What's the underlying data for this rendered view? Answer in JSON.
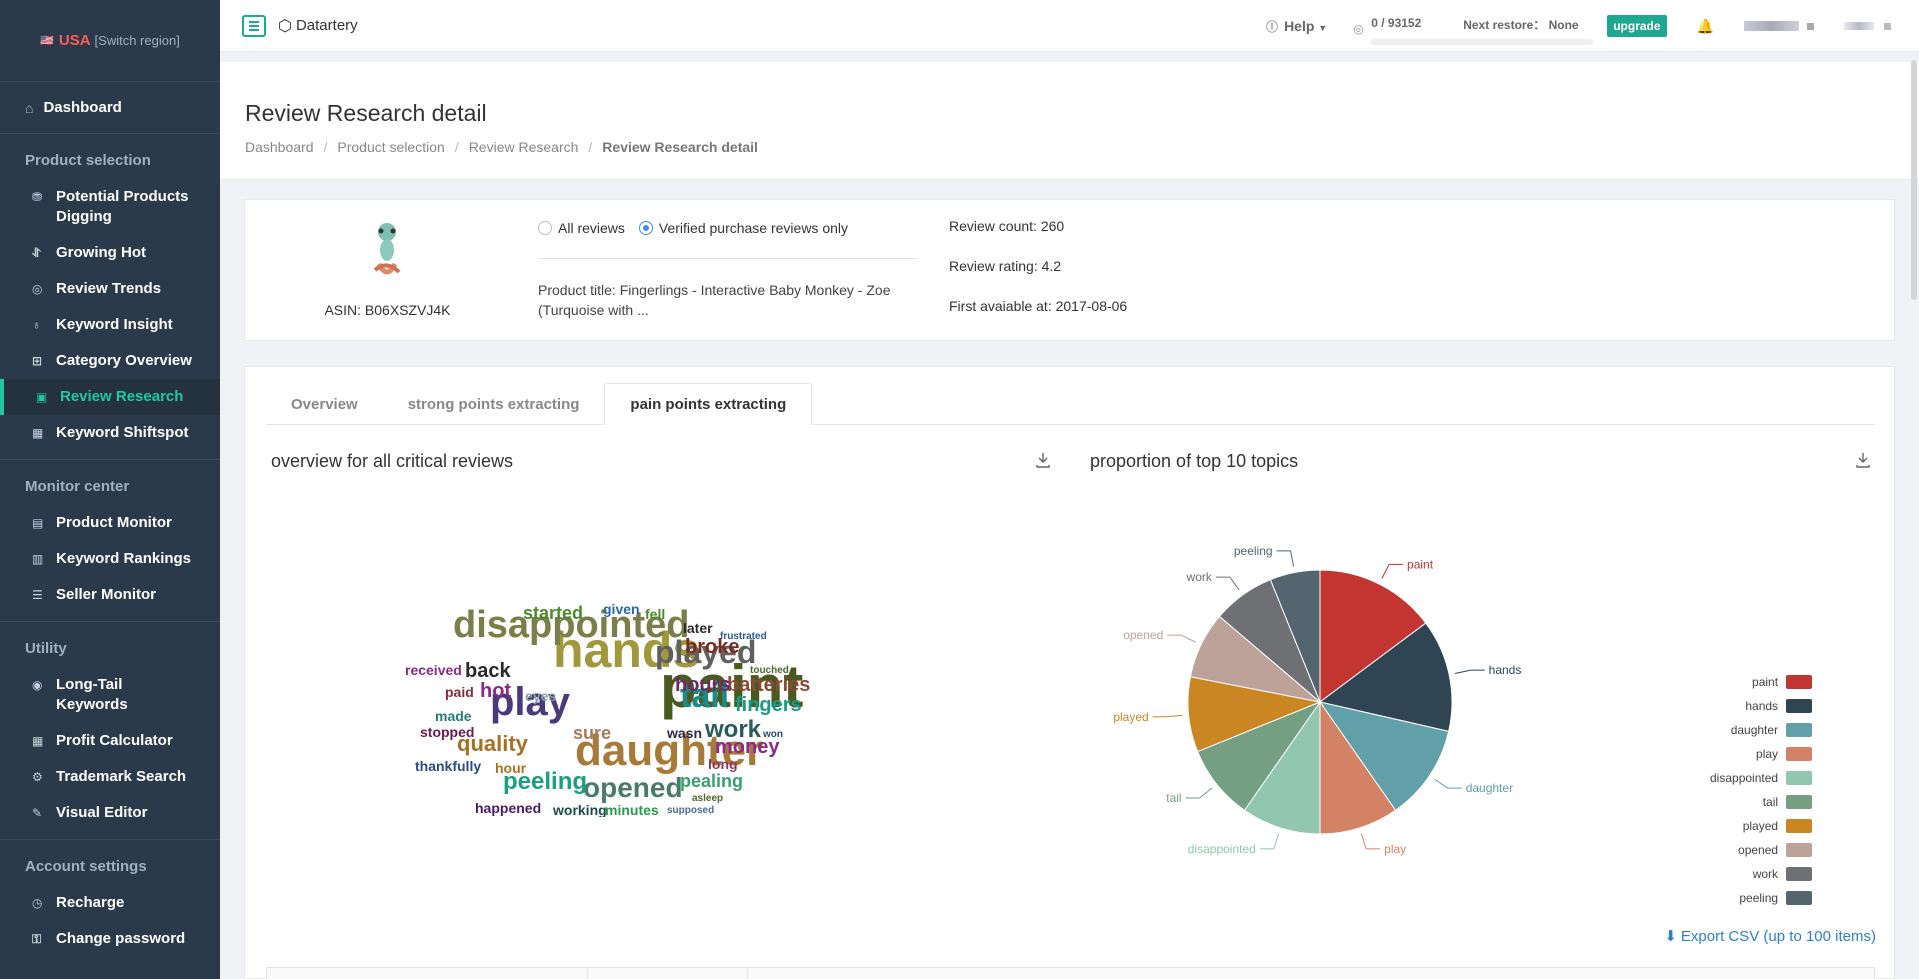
{
  "region": {
    "flag": "🇺🇸",
    "country": "USA",
    "switch": "[Switch region]"
  },
  "sidebar": {
    "dashboard": "Dashboard",
    "sections": [
      {
        "title": "Product selection",
        "items": [
          {
            "label": "Potential Products Digging",
            "icon": "dig-icon",
            "glyph": "⛃"
          },
          {
            "label": "Growing Hot",
            "icon": "trend-icon",
            "glyph": "⥯"
          },
          {
            "label": "Review Trends",
            "icon": "target-icon",
            "glyph": "◎"
          },
          {
            "label": "Keyword Insight",
            "icon": "bulb-icon",
            "glyph": "♁"
          },
          {
            "label": "Category Overview",
            "icon": "grid-icon",
            "glyph": "⊞"
          },
          {
            "label": "Review Research",
            "icon": "review-icon",
            "glyph": "▣",
            "active": true
          },
          {
            "label": "Keyword Shiftspot",
            "icon": "shift-icon",
            "glyph": "▦"
          }
        ]
      },
      {
        "title": "Monitor center",
        "items": [
          {
            "label": "Product Monitor",
            "icon": "monitor-icon",
            "glyph": "▤"
          },
          {
            "label": "Keyword Rankings",
            "icon": "bar-chart-icon",
            "glyph": "▥"
          },
          {
            "label": "Seller Monitor",
            "icon": "seller-icon",
            "glyph": "☰"
          }
        ]
      },
      {
        "title": "Utility",
        "items": [
          {
            "label": "Long-Tail Keywords",
            "icon": "keyword-icon",
            "glyph": "◉"
          },
          {
            "label": "Profit Calculator",
            "icon": "calculator-icon",
            "glyph": "▦"
          },
          {
            "label": "Trademark Search",
            "icon": "trademark-icon",
            "glyph": "⚙"
          },
          {
            "label": "Visual Editor",
            "icon": "edit-icon",
            "glyph": "✎"
          }
        ]
      },
      {
        "title": "Account settings",
        "items": [
          {
            "label": "Recharge",
            "icon": "recharge-icon",
            "glyph": "◷"
          },
          {
            "label": "Change password",
            "icon": "lock-icon",
            "glyph": "⚿"
          }
        ]
      }
    ]
  },
  "topbar": {
    "brand": "Datartery",
    "help": "Help",
    "quota_count": "0 / 93152",
    "next_restore_label": "Next restore：",
    "next_restore_value": "None",
    "upgrade": "upgrade"
  },
  "header": {
    "title": "Review Research detail",
    "breadcrumb": [
      "Dashboard",
      "Product selection",
      "Review Research",
      "Review Research detail"
    ]
  },
  "product": {
    "asin": "ASIN: B06XSZVJ4K",
    "filter_all": "All reviews",
    "filter_verified": "Verified purchase reviews only",
    "title": "Product title: Fingerlings - Interactive Baby Monkey - Zoe (Turquoise with ...",
    "review_count": "Review count: 260",
    "review_rating": "Review rating: 4.2",
    "first_available": "First avaiable at: 2017-08-06"
  },
  "tabs": [
    "Overview",
    "strong points extracting",
    "pain points extracting"
  ],
  "active_tab": 2,
  "wordcloud": {
    "title": "overview for all critical reviews",
    "words": [
      {
        "t": "paint",
        "c": "#4a5a1e",
        "s": 60
      },
      {
        "t": "hands",
        "c": "#a0983a",
        "s": 50
      },
      {
        "t": "daughter",
        "c": "#a87a3a",
        "s": 44
      },
      {
        "t": "disappointed",
        "c": "#7a7f4a",
        "s": 38
      },
      {
        "t": "play",
        "c": "#4a3a7a",
        "s": 40
      },
      {
        "t": "played",
        "c": "#606060",
        "s": 32
      },
      {
        "t": "tail",
        "c": "#1a8a8a",
        "s": 34
      },
      {
        "t": "opened",
        "c": "#4a7a6a",
        "s": 28
      },
      {
        "t": "peeling",
        "c": "#1aa080",
        "s": 24
      },
      {
        "t": "quality",
        "c": "#a87020",
        "s": 22
      },
      {
        "t": "work",
        "c": "#2a5a5a",
        "s": 24
      },
      {
        "t": "money",
        "c": "#8a2a8a",
        "s": 20
      },
      {
        "t": "pealing",
        "c": "#3aa070",
        "s": 18
      },
      {
        "t": "fingers",
        "c": "#1a9a8a",
        "s": 20
      },
      {
        "t": "batteries",
        "c": "#8a4a3a",
        "s": 20
      },
      {
        "t": "hours",
        "c": "#6a2a6a",
        "s": 20
      },
      {
        "t": "broke",
        "c": "#7a2a1a",
        "s": 20
      },
      {
        "t": "back",
        "c": "#2a2a2a",
        "s": 20
      },
      {
        "t": "hot",
        "c": "#8a2a8a",
        "s": 20
      },
      {
        "t": "sure",
        "c": "#a87a5a",
        "s": 18
      },
      {
        "t": "started",
        "c": "#4a8a2a",
        "s": 18
      },
      {
        "t": "received",
        "c": "#8a2a8a",
        "s": 14
      },
      {
        "t": "made",
        "c": "#2a7a7a",
        "s": 14
      },
      {
        "t": "stopped",
        "c": "#6a1a4a",
        "s": 14
      },
      {
        "t": "thankfully",
        "c": "#2a4a8a",
        "s": 14
      },
      {
        "t": "hour",
        "c": "#a87020",
        "s": 14
      },
      {
        "t": "happened",
        "c": "#4a1a6a",
        "s": 14
      },
      {
        "t": "working",
        "c": "#1a4a4a",
        "s": 14
      },
      {
        "t": "minutes",
        "c": "#2a9a4a",
        "s": 14
      },
      {
        "t": "wasn",
        "c": "#2a2a4a",
        "s": 14
      },
      {
        "t": "long",
        "c": "#8a3a5a",
        "s": 14
      },
      {
        "t": "given",
        "c": "#2a6a9a",
        "s": 14
      },
      {
        "t": "fell",
        "c": "#4a8a2a",
        "s": 14
      },
      {
        "t": "later",
        "c": "#2a2a2a",
        "s": 14
      },
      {
        "t": "paid",
        "c": "#8a2a3a",
        "s": 14
      },
      {
        "t": "eyes",
        "c": "#8aa0aa",
        "s": 14
      },
      {
        "t": "frustrated",
        "c": "#2a5a9a",
        "s": 10
      },
      {
        "t": "touched",
        "c": "#4a6a2a",
        "s": 10
      },
      {
        "t": "won",
        "c": "#2a4a6a",
        "s": 10
      },
      {
        "t": "asleep",
        "c": "#4a6a2a",
        "s": 10
      },
      {
        "t": "supposed",
        "c": "#4a6a9a",
        "s": 10
      }
    ]
  },
  "chart_data": {
    "type": "pie",
    "title": "proportion of top 10 topics",
    "legend_position": "right",
    "series": [
      {
        "name": "paint",
        "value": 14.5,
        "color": "#c23531"
      },
      {
        "name": "hands",
        "value": 13.5,
        "color": "#2f4554"
      },
      {
        "name": "daughter",
        "value": 11.5,
        "color": "#61a0a8"
      },
      {
        "name": "play",
        "value": 9.5,
        "color": "#d48265"
      },
      {
        "name": "disappointed",
        "value": 9.5,
        "color": "#91c7ae"
      },
      {
        "name": "tail",
        "value": 9.0,
        "color": "#749f83"
      },
      {
        "name": "played",
        "value": 9.0,
        "color": "#ca8622"
      },
      {
        "name": "opened",
        "value": 8.0,
        "color": "#bda29a"
      },
      {
        "name": "work",
        "value": 7.5,
        "color": "#6e7074"
      },
      {
        "name": "peeling",
        "value": 6.0,
        "color": "#546570"
      }
    ]
  },
  "export": "Export CSV (up to 100 items)"
}
